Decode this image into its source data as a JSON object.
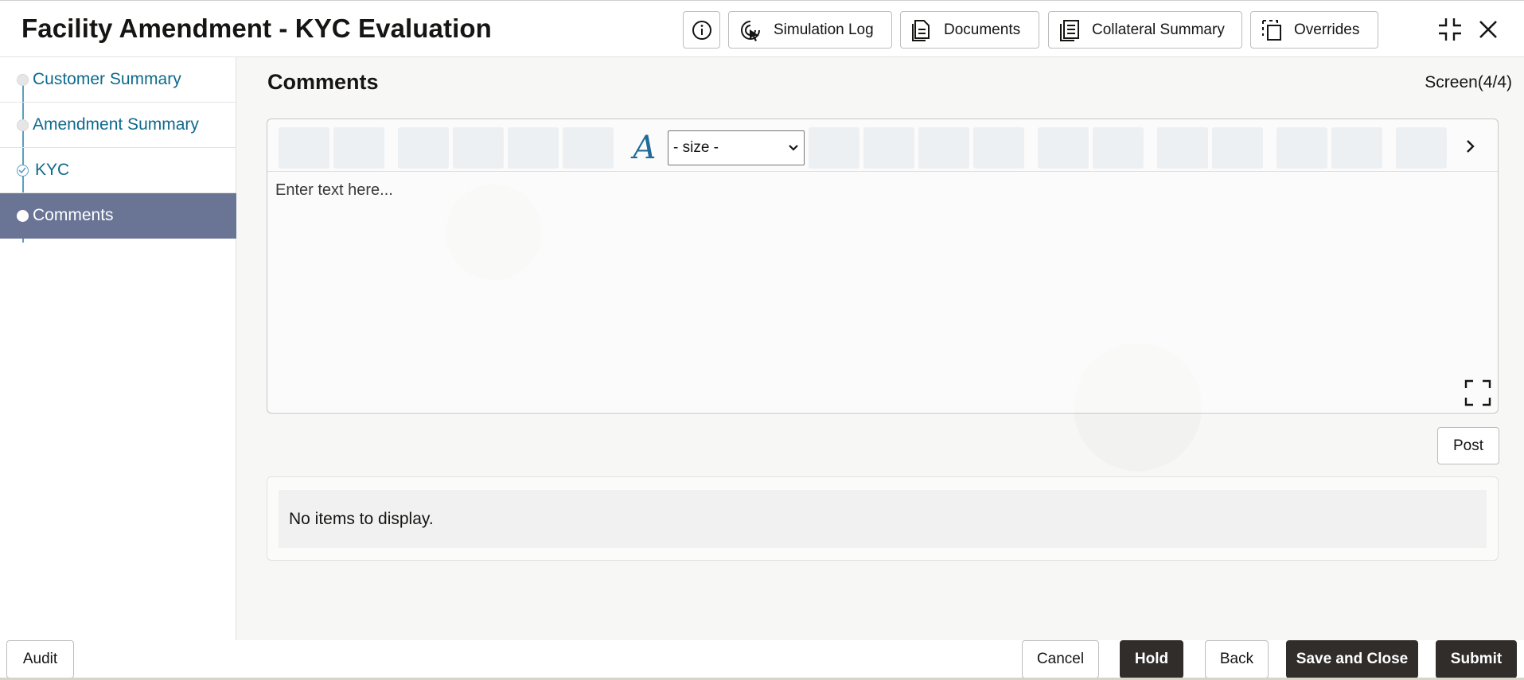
{
  "header": {
    "title": "Facility Amendment - KYC Evaluation",
    "buttons": {
      "simulation_log": "Simulation Log",
      "documents": "Documents",
      "collateral_summary": "Collateral Summary",
      "overrides": "Overrides"
    },
    "icons": [
      "info-icon",
      "simulation-log-icon",
      "documents-icon",
      "collateral-summary-icon",
      "overrides-icon",
      "collapse-icon",
      "close-icon"
    ]
  },
  "sidebar": {
    "items": [
      {
        "label": "Customer Summary",
        "state": "visited"
      },
      {
        "label": "Amendment Summary",
        "state": "visited"
      },
      {
        "label": "KYC",
        "state": "completed"
      },
      {
        "label": "Comments",
        "state": "active"
      }
    ]
  },
  "main": {
    "section_title": "Comments",
    "screen_indicator": "Screen(4/4)",
    "editor": {
      "size_select_value": "- size -",
      "placeholder": "Enter text here..."
    },
    "post_label": "Post",
    "empty_message": "No items to display."
  },
  "footer": {
    "audit": "Audit",
    "cancel": "Cancel",
    "hold": "Hold",
    "back": "Back",
    "save_and_close": "Save and Close",
    "submit": "Submit"
  },
  "colors": {
    "active_step_bg": "#6a7596",
    "link": "#0e6a8c",
    "dark_button": "#312d2a"
  }
}
